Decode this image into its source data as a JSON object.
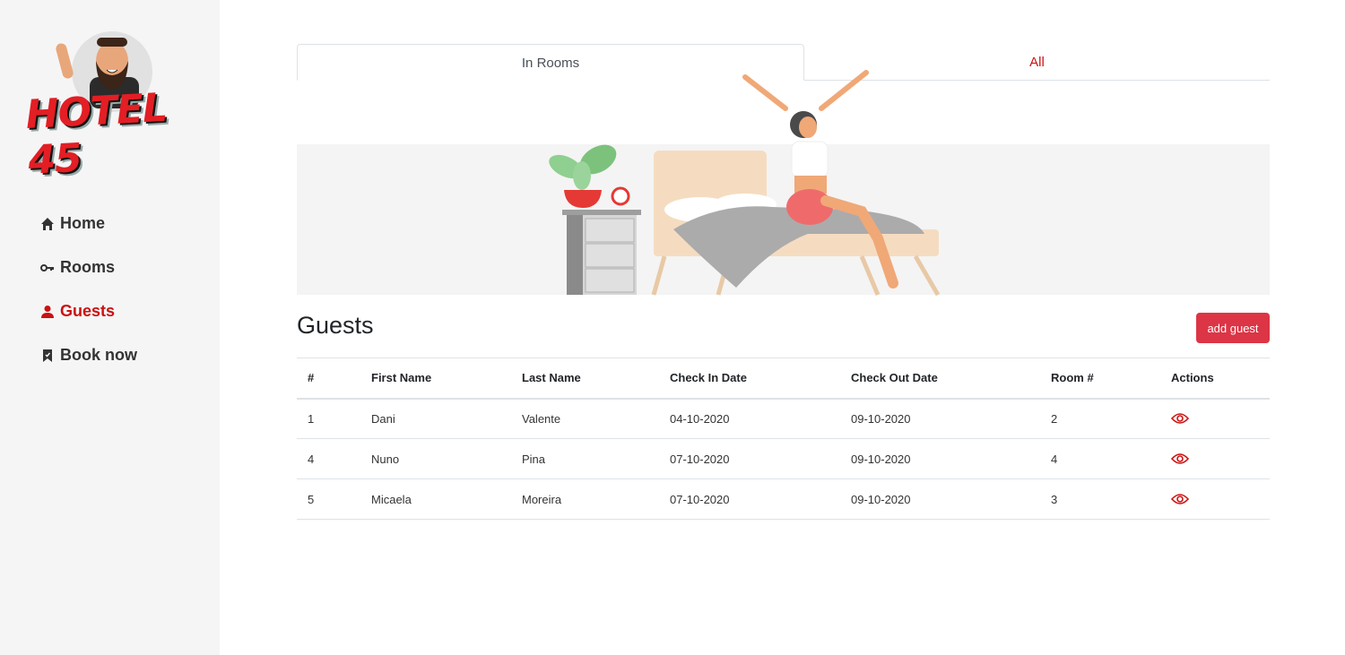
{
  "sidebar": {
    "logo_text": "HOTEL 45",
    "nav": [
      {
        "label": "Home",
        "icon": "home-icon",
        "active": false
      },
      {
        "label": "Rooms",
        "icon": "key-icon",
        "active": false
      },
      {
        "label": "Guests",
        "icon": "user-icon",
        "active": true
      },
      {
        "label": "Book now",
        "icon": "bookmark-icon",
        "active": false
      }
    ]
  },
  "tabs": [
    {
      "label": "In Rooms",
      "active": true
    },
    {
      "label": "All",
      "active": false
    }
  ],
  "main": {
    "title": "Guests",
    "add_button": "add guest"
  },
  "table": {
    "columns": [
      "#",
      "First Name",
      "Last Name",
      "Check In Date",
      "Check Out Date",
      "Room #",
      "Actions"
    ],
    "rows": [
      {
        "id": "1",
        "first": "Dani",
        "last": "Valente",
        "checkin": "04-10-2020",
        "checkout": "09-10-2020",
        "room": "2"
      },
      {
        "id": "4",
        "first": "Nuno",
        "last": "Pina",
        "checkin": "07-10-2020",
        "checkout": "09-10-2020",
        "room": "4"
      },
      {
        "id": "5",
        "first": "Micaela",
        "last": "Moreira",
        "checkin": "07-10-2020",
        "checkout": "09-10-2020",
        "room": "3"
      }
    ]
  },
  "colors": {
    "accent": "#cc1111",
    "button": "#dc3545",
    "sidebar_bg": "#f5f5f5"
  }
}
